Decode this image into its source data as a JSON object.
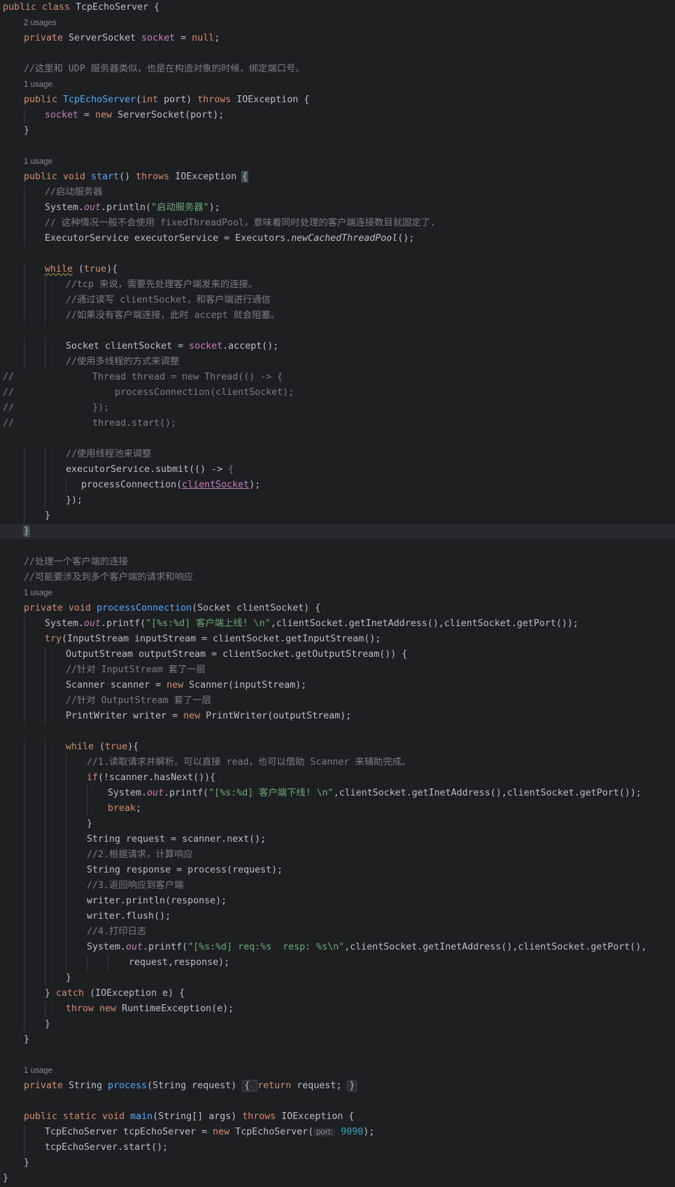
{
  "editor": {
    "language": "java",
    "file_class": "TcpEchoServer",
    "lines": [
      {
        "indent": 0,
        "tokens": [
          [
            "kw",
            "public class "
          ],
          [
            "typ",
            "TcpEchoServer {"
          ]
        ]
      },
      {
        "indent": 1,
        "hint": "2 usages"
      },
      {
        "indent": 1,
        "tokens": [
          [
            "kw",
            "private "
          ],
          [
            "typ",
            "ServerSocket "
          ],
          [
            "fld",
            "socket"
          ],
          [
            "typ",
            " = "
          ],
          [
            "kw",
            "null"
          ],
          [
            "typ",
            ";"
          ]
        ]
      },
      {
        "indent": 0,
        "tokens": []
      },
      {
        "indent": 1,
        "tokens": [
          [
            "cm",
            "//这里和 UDP 服务器类似，也是在构造对象的时候，绑定端口号。"
          ]
        ]
      },
      {
        "indent": 1,
        "hint": "1 usage"
      },
      {
        "indent": 1,
        "tokens": [
          [
            "kw",
            "public "
          ],
          [
            "fn",
            "TcpEchoServer"
          ],
          [
            "typ",
            "("
          ],
          [
            "kw",
            "int "
          ],
          [
            "typ",
            "port) "
          ],
          [
            "kw",
            "throws "
          ],
          [
            "typ",
            "IOException {"
          ]
        ]
      },
      {
        "indent": 2,
        "tokens": [
          [
            "fld",
            "socket"
          ],
          [
            "typ",
            " = "
          ],
          [
            "kw",
            "new "
          ],
          [
            "typ",
            "ServerSocket(port);"
          ]
        ]
      },
      {
        "indent": 1,
        "tokens": [
          [
            "typ",
            "}"
          ]
        ]
      },
      {
        "indent": 0,
        "tokens": []
      },
      {
        "indent": 1,
        "hint": "1 usage"
      },
      {
        "indent": 1,
        "tokens": [
          [
            "kw",
            "public void "
          ],
          [
            "fn",
            "start"
          ],
          [
            "typ",
            "() "
          ],
          [
            "kw",
            "throws "
          ],
          [
            "typ",
            "IOException "
          ],
          [
            "bh",
            "{"
          ]
        ]
      },
      {
        "indent": 2,
        "tokens": [
          [
            "cm",
            "//启动服务器"
          ]
        ]
      },
      {
        "indent": 2,
        "tokens": [
          [
            "typ",
            "System."
          ],
          [
            "fldit",
            "out"
          ],
          [
            "typ",
            ".println("
          ],
          [
            "str",
            "\"启动服务器\""
          ],
          [
            "typ",
            ");"
          ]
        ]
      },
      {
        "indent": 2,
        "tokens": [
          [
            "cm",
            "// 这种情况一般不会使用 fixedThreadPool，意味着同时处理的客户端连接数目就固定了."
          ]
        ]
      },
      {
        "indent": 2,
        "tokens": [
          [
            "typ",
            "ExecutorService executorService = Executors."
          ],
          [
            "it",
            "newCachedThreadPool"
          ],
          [
            "typ",
            "();"
          ]
        ]
      },
      {
        "indent": 0,
        "tokens": []
      },
      {
        "indent": 2,
        "tokens": [
          [
            "kwwavy",
            "while"
          ],
          [
            "typ",
            " ("
          ],
          [
            "kw",
            "true"
          ],
          [
            "typ",
            "){"
          ]
        ]
      },
      {
        "indent": 3,
        "tokens": [
          [
            "cm",
            "//tcp 来说，需要先处理客户端发来的连接。"
          ]
        ]
      },
      {
        "indent": 3,
        "tokens": [
          [
            "cm",
            "//通过读写 clientSocket，和客户端进行通信"
          ]
        ]
      },
      {
        "indent": 3,
        "tokens": [
          [
            "cm",
            "//如果没有客户端连接，此时 accept 就会阻塞。"
          ]
        ]
      },
      {
        "indent": 0,
        "tokens": []
      },
      {
        "indent": 3,
        "tokens": [
          [
            "typ",
            "Socket clientSocket = "
          ],
          [
            "fld",
            "socket"
          ],
          [
            "typ",
            ".accept();"
          ]
        ]
      },
      {
        "indent": 3,
        "tokens": [
          [
            "cm",
            "//使用多线程的方式来调整"
          ]
        ]
      },
      {
        "indent": 0,
        "tokens": [
          [
            "cm",
            "//              Thread thread = new Thread(() -> {"
          ]
        ]
      },
      {
        "indent": 0,
        "tokens": [
          [
            "cm",
            "//                  processConnection(clientSocket);"
          ]
        ]
      },
      {
        "indent": 0,
        "tokens": [
          [
            "cm",
            "//              });"
          ]
        ]
      },
      {
        "indent": 0,
        "tokens": [
          [
            "cm",
            "//              thread.start();"
          ]
        ]
      },
      {
        "indent": 0,
        "tokens": []
      },
      {
        "indent": 3,
        "tokens": [
          [
            "cm",
            "//使用线程池来调整"
          ]
        ]
      },
      {
        "indent": 3,
        "tokens": [
          [
            "typ",
            "executorService.submit(() -> "
          ],
          [
            "cm",
            "{"
          ]
        ]
      },
      {
        "indent": 3,
        "extra": 1,
        "tokens": [
          [
            "typ",
            "processConnection("
          ],
          [
            "fldund",
            "clientSocket"
          ],
          [
            "typ",
            ");"
          ]
        ]
      },
      {
        "indent": 3,
        "tokens": [
          [
            "typ",
            "});"
          ]
        ]
      },
      {
        "indent": 2,
        "tokens": [
          [
            "typ",
            "}"
          ]
        ]
      },
      {
        "indent": 1,
        "hl": true,
        "tokens": [
          [
            "bh",
            "}"
          ]
        ]
      },
      {
        "indent": 0,
        "tokens": []
      },
      {
        "indent": 1,
        "tokens": [
          [
            "cm",
            "//处理一个客户端的连接"
          ]
        ]
      },
      {
        "indent": 1,
        "tokens": [
          [
            "cm",
            "//可能要涉及到多个客户端的请求和响应"
          ]
        ]
      },
      {
        "indent": 1,
        "hint": "1 usage"
      },
      {
        "indent": 1,
        "tokens": [
          [
            "kw",
            "private void "
          ],
          [
            "fn",
            "processConnection"
          ],
          [
            "typ",
            "(Socket clientSocket) {"
          ]
        ]
      },
      {
        "indent": 2,
        "tokens": [
          [
            "typ",
            "System."
          ],
          [
            "fldit",
            "out"
          ],
          [
            "typ",
            ".printf("
          ],
          [
            "str",
            "\"[%s:%d] 客户端上线! \\n\""
          ],
          [
            "typ",
            ",clientSocket.getInetAddress(),clientSocket.getPort());"
          ]
        ]
      },
      {
        "indent": 2,
        "tokens": [
          [
            "kw",
            "try"
          ],
          [
            "typ",
            "(InputStream inputStream = clientSocket.getInputStream();"
          ]
        ]
      },
      {
        "indent": 3,
        "tokens": [
          [
            "typ",
            "OutputStream outputStream = clientSocket.getOutputStream()) {"
          ]
        ]
      },
      {
        "indent": 3,
        "tokens": [
          [
            "cm",
            "//针对 InputStream 套了一层"
          ]
        ]
      },
      {
        "indent": 3,
        "tokens": [
          [
            "typ",
            "Scanner scanner = "
          ],
          [
            "kw",
            "new "
          ],
          [
            "typ",
            "Scanner(inputStream);"
          ]
        ]
      },
      {
        "indent": 3,
        "tokens": [
          [
            "cm",
            "//针对 OutputStream 套了一层"
          ]
        ]
      },
      {
        "indent": 3,
        "tokens": [
          [
            "typ",
            "PrintWriter writer = "
          ],
          [
            "kw",
            "new "
          ],
          [
            "typ",
            "PrintWriter(outputStream);"
          ]
        ]
      },
      {
        "indent": 0,
        "tokens": []
      },
      {
        "indent": 3,
        "tokens": [
          [
            "kw",
            "while"
          ],
          [
            "typ",
            " ("
          ],
          [
            "kw",
            "true"
          ],
          [
            "typ",
            "){"
          ]
        ]
      },
      {
        "indent": 4,
        "tokens": [
          [
            "cm",
            "//1.读取请求并解析。可以直接 read，也可以借助 Scanner 来辅助完成。"
          ]
        ]
      },
      {
        "indent": 4,
        "tokens": [
          [
            "kw",
            "if"
          ],
          [
            "typ",
            "(!scanner.hasNext()){"
          ]
        ]
      },
      {
        "indent": 5,
        "tokens": [
          [
            "typ",
            "System."
          ],
          [
            "fldit",
            "out"
          ],
          [
            "typ",
            ".printf("
          ],
          [
            "str",
            "\"[%s:%d] 客户端下线! \\n\""
          ],
          [
            "typ",
            ",clientSocket.getInetAddress(),clientSocket.getPort());"
          ]
        ]
      },
      {
        "indent": 5,
        "tokens": [
          [
            "kw",
            "break"
          ],
          [
            "typ",
            ";"
          ]
        ]
      },
      {
        "indent": 4,
        "tokens": [
          [
            "typ",
            "}"
          ]
        ]
      },
      {
        "indent": 4,
        "tokens": [
          [
            "typ",
            "String request = scanner.next();"
          ]
        ]
      },
      {
        "indent": 4,
        "tokens": [
          [
            "cm",
            "//2.根据请求，计算响应"
          ]
        ]
      },
      {
        "indent": 4,
        "tokens": [
          [
            "typ",
            "String response = process(request);"
          ]
        ]
      },
      {
        "indent": 4,
        "tokens": [
          [
            "cm",
            "//3.返回响应到客户端"
          ]
        ]
      },
      {
        "indent": 4,
        "tokens": [
          [
            "typ",
            "writer.println(response);"
          ]
        ]
      },
      {
        "indent": 4,
        "tokens": [
          [
            "typ",
            "writer.flush();"
          ]
        ]
      },
      {
        "indent": 4,
        "tokens": [
          [
            "cm",
            "//4.打印日志"
          ]
        ]
      },
      {
        "indent": 4,
        "tokens": [
          [
            "typ",
            "System."
          ],
          [
            "fldit",
            "out"
          ],
          [
            "typ",
            ".printf("
          ],
          [
            "str",
            "\"[%s:%d] req:%s  resp: %s\\n\""
          ],
          [
            "typ",
            ",clientSocket.getInetAddress(),clientSocket.getPort(),"
          ]
        ]
      },
      {
        "indent": 6,
        "tokens": [
          [
            "typ",
            "request,response);"
          ]
        ]
      },
      {
        "indent": 3,
        "tokens": [
          [
            "typ",
            "}"
          ]
        ]
      },
      {
        "indent": 2,
        "tokens": [
          [
            "typ",
            "} "
          ],
          [
            "kw",
            "catch "
          ],
          [
            "typ",
            "(IOException e) {"
          ]
        ]
      },
      {
        "indent": 3,
        "tokens": [
          [
            "kw",
            "throw new "
          ],
          [
            "typ",
            "RuntimeException(e);"
          ]
        ]
      },
      {
        "indent": 2,
        "tokens": [
          [
            "typ",
            "}"
          ]
        ]
      },
      {
        "indent": 1,
        "tokens": [
          [
            "typ",
            "}"
          ]
        ]
      },
      {
        "indent": 0,
        "tokens": []
      },
      {
        "indent": 1,
        "hint": "1 usage"
      },
      {
        "indent": 1,
        "tokens": [
          [
            "kw",
            "private "
          ],
          [
            "typ",
            "String "
          ],
          [
            "fn",
            "process"
          ],
          [
            "typ",
            "(String request) "
          ],
          [
            "fold",
            "{ "
          ],
          [
            "kw",
            "return "
          ],
          [
            "typ",
            "request; "
          ],
          [
            "fold",
            "}"
          ]
        ]
      },
      {
        "indent": 0,
        "tokens": []
      },
      {
        "indent": 1,
        "tokens": [
          [
            "kw",
            "public static void "
          ],
          [
            "fn",
            "main"
          ],
          [
            "typ",
            "(String[] args) "
          ],
          [
            "kw",
            "throws "
          ],
          [
            "typ",
            "IOException {"
          ]
        ]
      },
      {
        "indent": 2,
        "tokens": [
          [
            "typ",
            "TcpEchoServer tcpEchoServer = "
          ],
          [
            "kw",
            "new "
          ],
          [
            "typ",
            "TcpEchoServer("
          ],
          [
            "inlay",
            "port:"
          ],
          [
            "num",
            " 9090"
          ],
          [
            "typ",
            ");"
          ]
        ]
      },
      {
        "indent": 2,
        "tokens": [
          [
            "typ",
            "tcpEchoServer.start();"
          ]
        ]
      },
      {
        "indent": 1,
        "tokens": [
          [
            "typ",
            "}"
          ]
        ]
      },
      {
        "indent": 0,
        "tokens": [
          [
            "typ",
            "}"
          ]
        ]
      }
    ]
  }
}
